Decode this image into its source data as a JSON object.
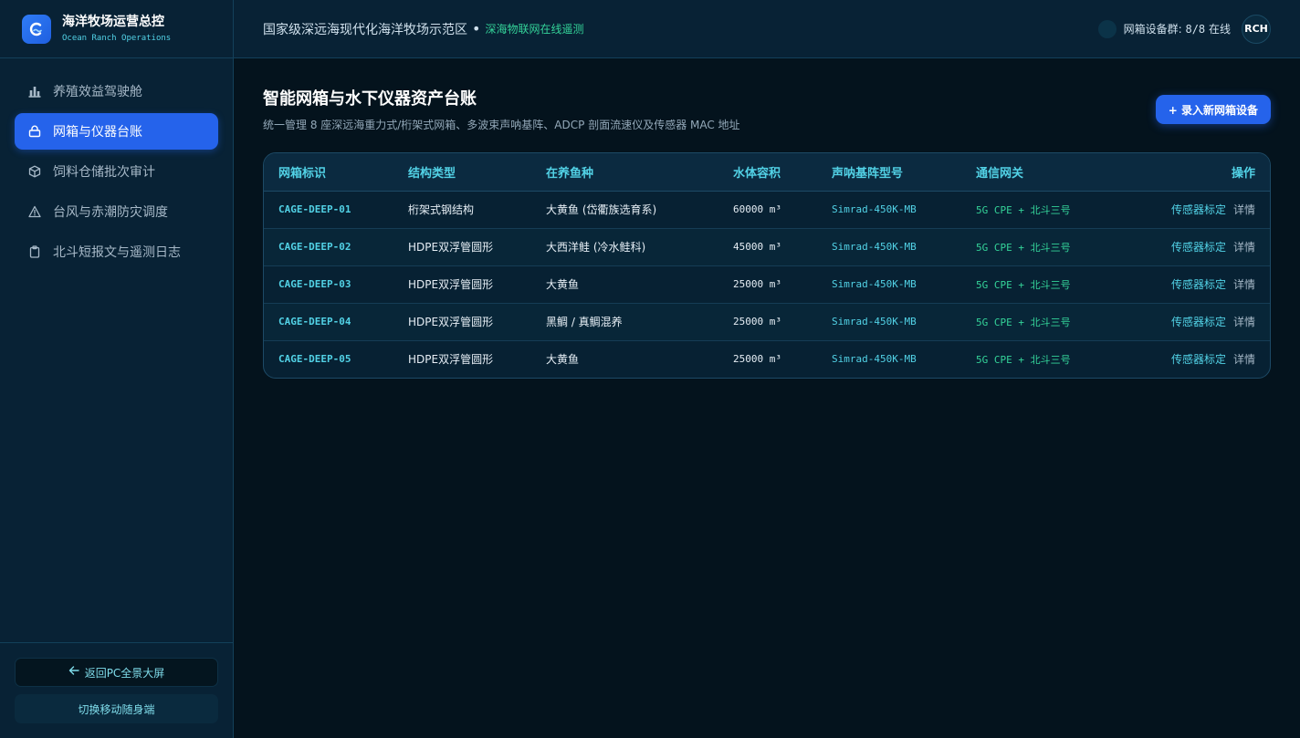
{
  "brand": {
    "title": "海洋牧场运营总控",
    "subtitle": "Ocean Ranch Operations"
  },
  "sidebar": {
    "items": [
      {
        "label": "养殖效益驾驶舱",
        "icon": "bar-chart-icon",
        "active": false
      },
      {
        "label": "网箱与仪器台账",
        "icon": "box-lock-icon",
        "active": true
      },
      {
        "label": "饲料仓储批次审计",
        "icon": "cube-icon",
        "active": false
      },
      {
        "label": "台风与赤潮防灾调度",
        "icon": "warning-triangle-icon",
        "active": false
      },
      {
        "label": "北斗短报文与遥测日志",
        "icon": "clipboard-icon",
        "active": false
      }
    ],
    "back_label": "返回PC全景大屏",
    "mobile_label": "切换移动随身端"
  },
  "header": {
    "crumb": "国家级深远海现代化海洋牧场示范区",
    "sub": "深海物联网在线遥测",
    "status_label": "网箱设备群:",
    "status_value": "8/8",
    "status_suffix": "在线",
    "avatar": "RCH"
  },
  "main": {
    "title": "智能网箱与水下仪器资产台账",
    "desc": "统一管理 8 座深远海重力式/桁架式网箱、多波束声呐基阵、ADCP 剖面流速仪及传感器 MAC 地址",
    "add_button": "+ 录入新网箱设备"
  },
  "table": {
    "headers": [
      "网箱标识",
      "结构类型",
      "在养鱼种",
      "水体容积",
      "声呐基阵型号",
      "通信网关",
      "操作"
    ],
    "rows": [
      {
        "id": "CAGE-DEEP-01",
        "structure": "桁架式钢结构",
        "species": "大黄鱼 (岱衢族选育系)",
        "volume": "60000 m³",
        "sonar": "Simrad-450K-MB",
        "gateway": "5G CPE + 北斗三号"
      },
      {
        "id": "CAGE-DEEP-02",
        "structure": "HDPE双浮管圆形",
        "species": "大西洋鲑 (冷水鲑科)",
        "volume": "45000 m³",
        "sonar": "Simrad-450K-MB",
        "gateway": "5G CPE + 北斗三号"
      },
      {
        "id": "CAGE-DEEP-03",
        "structure": "HDPE双浮管圆形",
        "species": "大黄鱼",
        "volume": "25000 m³",
        "sonar": "Simrad-450K-MB",
        "gateway": "5G CPE + 北斗三号"
      },
      {
        "id": "CAGE-DEEP-04",
        "structure": "HDPE双浮管圆形",
        "species": "黑鲷 / 真鲷混养",
        "volume": "25000 m³",
        "sonar": "Simrad-450K-MB",
        "gateway": "5G CPE + 北斗三号"
      },
      {
        "id": "CAGE-DEEP-05",
        "structure": "HDPE双浮管圆形",
        "species": "大黄鱼",
        "volume": "25000 m³",
        "sonar": "Simrad-450K-MB",
        "gateway": "5G CPE + 北斗三号"
      }
    ],
    "op_calibrate": "传感器标定",
    "op_detail": "详情"
  },
  "colors": {
    "accent": "#2563eb",
    "cyan": "#52d2e6",
    "green": "#34d399",
    "background": "#04131d",
    "panel": "#082235"
  }
}
